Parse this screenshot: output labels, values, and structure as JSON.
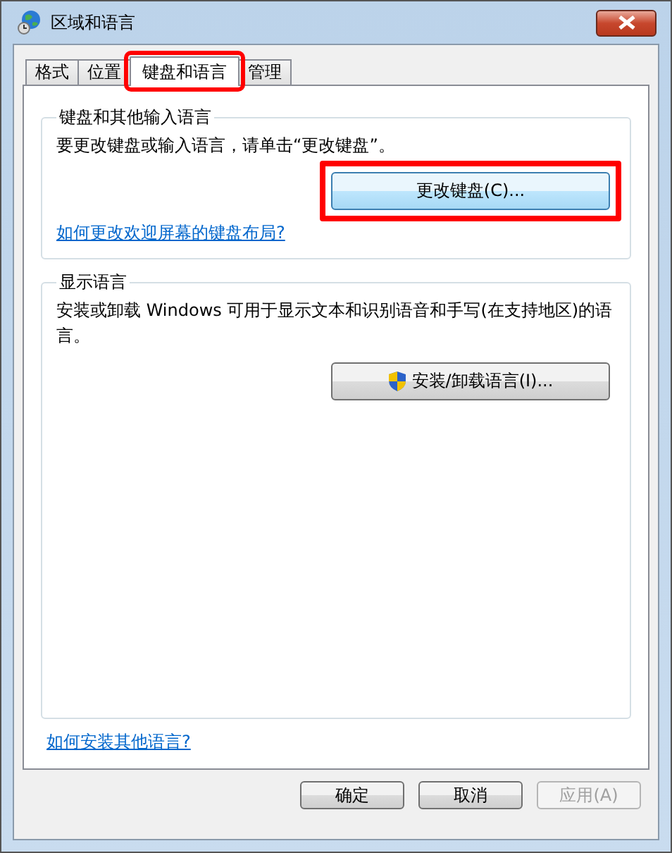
{
  "window": {
    "title": "区域和语言"
  },
  "tabs": [
    {
      "label": "格式",
      "selected": false,
      "highlighted": false
    },
    {
      "label": "位置",
      "selected": false,
      "highlighted": false
    },
    {
      "label": "键盘和语言",
      "selected": true,
      "highlighted": true
    },
    {
      "label": "管理",
      "selected": false,
      "highlighted": false
    }
  ],
  "keyboard_group": {
    "title": "键盘和其他输入语言",
    "description": "要更改键盘或输入语言，请单击“更改键盘”。",
    "button": {
      "label": "更改键盘(C)...",
      "focused": true,
      "highlighted": true
    },
    "link": "如何更改欢迎屏幕的键盘布局?"
  },
  "display_group": {
    "title": "显示语言",
    "description": "安装或卸载 Windows 可用于显示文本和识别语音和手写(在支持地区)的语言。",
    "button": {
      "label": "安装/卸载语言(I)...",
      "focused": false
    }
  },
  "link": "如何安装其他语言?",
  "buttons": [
    {
      "label": "确定",
      "disabled": false
    },
    {
      "label": "取消",
      "disabled": false
    },
    {
      "label": "应用(A)",
      "disabled": true
    }
  ]
}
